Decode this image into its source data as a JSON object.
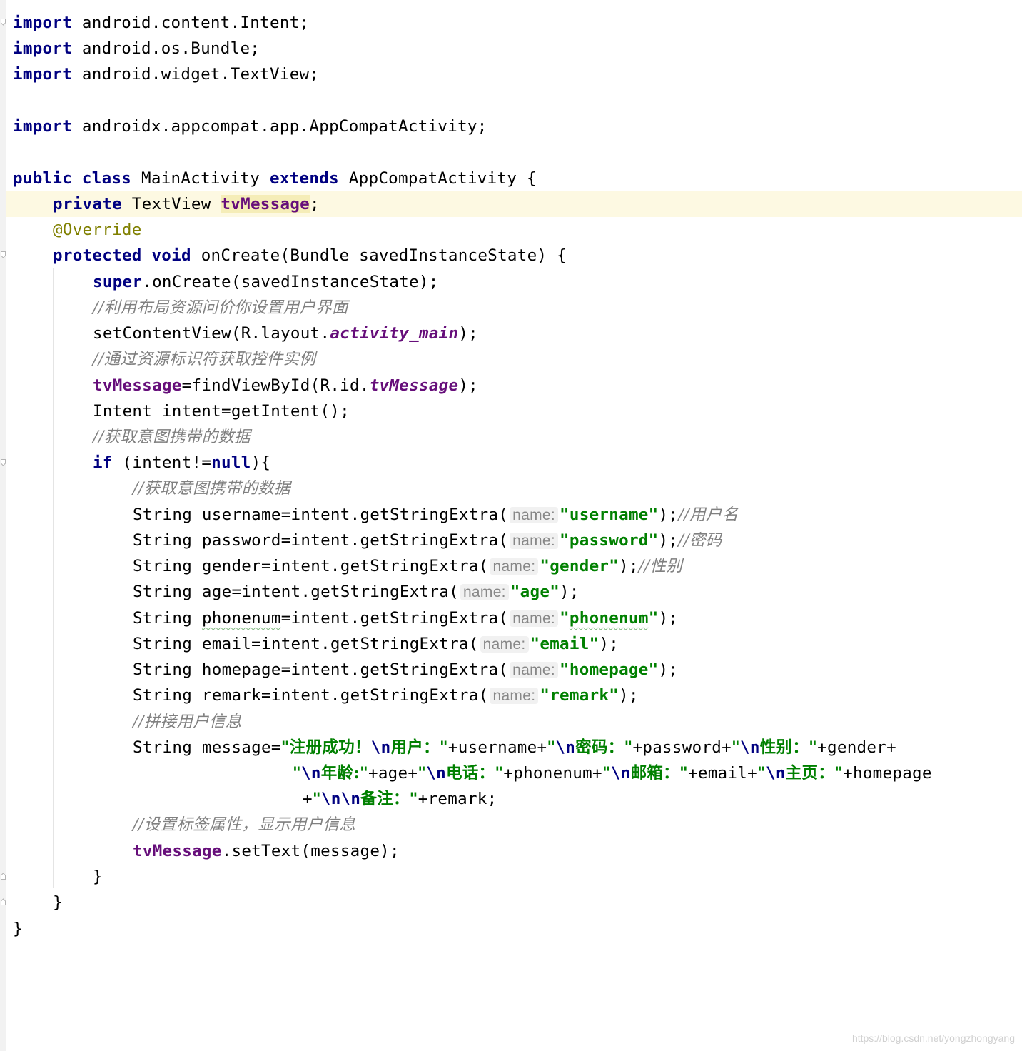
{
  "editor": {
    "lines": [
      [
        {
          "t": "import",
          "c": "kw"
        },
        {
          "t": " android.content.Intent;"
        }
      ],
      [
        {
          "t": "import",
          "c": "kw"
        },
        {
          "t": " android.os.Bundle;"
        }
      ],
      [
        {
          "t": "import",
          "c": "kw"
        },
        {
          "t": " android.widget.TextView;"
        }
      ],
      [
        {
          "t": "import",
          "c": "kw"
        },
        {
          "t": " androidx.appcompat.app.AppCompatActivity;"
        }
      ],
      [
        {
          "t": "public class",
          "c": "kw"
        },
        {
          "t": " MainActivity "
        },
        {
          "t": "extends",
          "c": "kw"
        },
        {
          "t": " AppCompatActivity {"
        }
      ],
      [
        {
          "t": "private",
          "c": "kw"
        },
        {
          "t": " TextView "
        },
        {
          "t": "tvMessage",
          "c": "field hl"
        },
        {
          "t": ";"
        }
      ],
      [
        {
          "t": "@Override",
          "c": "ann"
        }
      ],
      [
        {
          "t": "protected void",
          "c": "kw"
        },
        {
          "t": " onCreate(Bundle savedInstanceState) {"
        }
      ],
      [
        {
          "t": "super",
          "c": "kw"
        },
        {
          "t": ".onCreate(savedInstanceState);"
        }
      ],
      [
        {
          "t": "//利用布局资源问价你设置用户界面",
          "c": "comment"
        }
      ],
      [
        {
          "t": "setContentView(R.layout."
        },
        {
          "t": "activity_main",
          "c": "static"
        },
        {
          "t": ");"
        }
      ],
      [
        {
          "t": "//通过资源标识符获取控件实例",
          "c": "comment"
        }
      ],
      [
        {
          "t": "tvMessage",
          "c": "field"
        },
        {
          "t": "=findViewById(R.id."
        },
        {
          "t": "tvMessage",
          "c": "static"
        },
        {
          "t": ");"
        }
      ],
      [
        {
          "t": "Intent intent=getIntent();"
        }
      ],
      [
        {
          "t": "//获取意图携带的数据",
          "c": "comment"
        }
      ],
      [
        {
          "t": "if",
          "c": "kw"
        },
        {
          "t": " (intent!="
        },
        {
          "t": "null",
          "c": "kw"
        },
        {
          "t": "){"
        }
      ],
      [
        {
          "t": "//获取意图携带的数据",
          "c": "comment"
        }
      ],
      [
        {
          "t": "String username=intent.getStringExtra("
        },
        {
          "t": "name:",
          "c": "hint"
        },
        {
          "t": "\"username\"",
          "c": "str"
        },
        {
          "t": ");"
        },
        {
          "t": "//用户名",
          "c": "comment"
        }
      ],
      [
        {
          "t": "String password=intent.getStringExtra("
        },
        {
          "t": "name:",
          "c": "hint"
        },
        {
          "t": "\"password\"",
          "c": "str"
        },
        {
          "t": ");"
        },
        {
          "t": "//密码",
          "c": "comment"
        }
      ],
      [
        {
          "t": "String gender=intent.getStringExtra("
        },
        {
          "t": "name:",
          "c": "hint"
        },
        {
          "t": "\"gender\"",
          "c": "str"
        },
        {
          "t": ");"
        },
        {
          "t": "//性别",
          "c": "comment"
        }
      ],
      [
        {
          "t": "String age=intent.getStringExtra("
        },
        {
          "t": "name:",
          "c": "hint"
        },
        {
          "t": "\"age\"",
          "c": "str"
        },
        {
          "t": ");"
        }
      ],
      [
        {
          "t": "String "
        },
        {
          "t": "phonenum",
          "c": "squiggle"
        },
        {
          "t": "=intent.getStringExtra("
        },
        {
          "t": "name:",
          "c": "hint"
        },
        {
          "t": "\"",
          "c": "str"
        },
        {
          "t": "phonenum",
          "c": "str squiggle"
        },
        {
          "t": "\"",
          "c": "str"
        },
        {
          "t": ");"
        }
      ],
      [
        {
          "t": "String email=intent.getStringExtra("
        },
        {
          "t": "name:",
          "c": "hint"
        },
        {
          "t": "\"email\"",
          "c": "str"
        },
        {
          "t": ");"
        }
      ],
      [
        {
          "t": "String homepage=intent.getStringExtra("
        },
        {
          "t": "name:",
          "c": "hint"
        },
        {
          "t": "\"homepage\"",
          "c": "str"
        },
        {
          "t": ");"
        }
      ],
      [
        {
          "t": "String remark=intent.getStringExtra("
        },
        {
          "t": "name:",
          "c": "hint"
        },
        {
          "t": "\"remark\"",
          "c": "str"
        },
        {
          "t": ");"
        }
      ],
      [
        {
          "t": "//拼接用户信息",
          "c": "comment"
        }
      ],
      [
        {
          "t": "String message="
        },
        {
          "t": "\"注册成功！",
          "c": "str-cn"
        },
        {
          "t": "\\n",
          "c": "esc"
        },
        {
          "t": "用户：\"",
          "c": "str-cn"
        },
        {
          "t": "+username+"
        },
        {
          "t": "\"",
          "c": "str-cn"
        },
        {
          "t": "\\n",
          "c": "esc"
        },
        {
          "t": "密码：\"",
          "c": "str-cn"
        },
        {
          "t": "+password+"
        },
        {
          "t": "\"",
          "c": "str-cn"
        },
        {
          "t": "\\n",
          "c": "esc"
        },
        {
          "t": "性别：\"",
          "c": "str-cn"
        },
        {
          "t": "+gender+"
        }
      ],
      [
        {
          "t": "\"",
          "c": "str-cn"
        },
        {
          "t": "\\n",
          "c": "esc"
        },
        {
          "t": "年龄:\"",
          "c": "str-cn"
        },
        {
          "t": "+age+"
        },
        {
          "t": "\"",
          "c": "str-cn"
        },
        {
          "t": "\\n",
          "c": "esc"
        },
        {
          "t": "电话：\"",
          "c": "str-cn"
        },
        {
          "t": "+phonenum+"
        },
        {
          "t": "\"",
          "c": "str-cn"
        },
        {
          "t": "\\n",
          "c": "esc"
        },
        {
          "t": "邮箱：\"",
          "c": "str-cn"
        },
        {
          "t": "+email+"
        },
        {
          "t": "\"",
          "c": "str-cn"
        },
        {
          "t": "\\n",
          "c": "esc"
        },
        {
          "t": "主页：\"",
          "c": "str-cn"
        },
        {
          "t": "+homepage"
        }
      ],
      [
        {
          "t": "+"
        },
        {
          "t": "\"",
          "c": "str-cn"
        },
        {
          "t": "\\n\\n",
          "c": "esc"
        },
        {
          "t": "备注：\"",
          "c": "str-cn"
        },
        {
          "t": "+remark;"
        }
      ],
      [
        {
          "t": "//设置标签属性，显示用户信息",
          "c": "comment"
        }
      ],
      [
        {
          "t": "tvMessage",
          "c": "field"
        },
        {
          "t": ".setText(message);"
        }
      ],
      [
        {
          "t": "}"
        }
      ],
      [
        {
          "t": "}"
        }
      ],
      [
        {
          "t": "}"
        }
      ]
    ]
  },
  "watermark": "https://blog.csdn.net/yongzhongyang"
}
